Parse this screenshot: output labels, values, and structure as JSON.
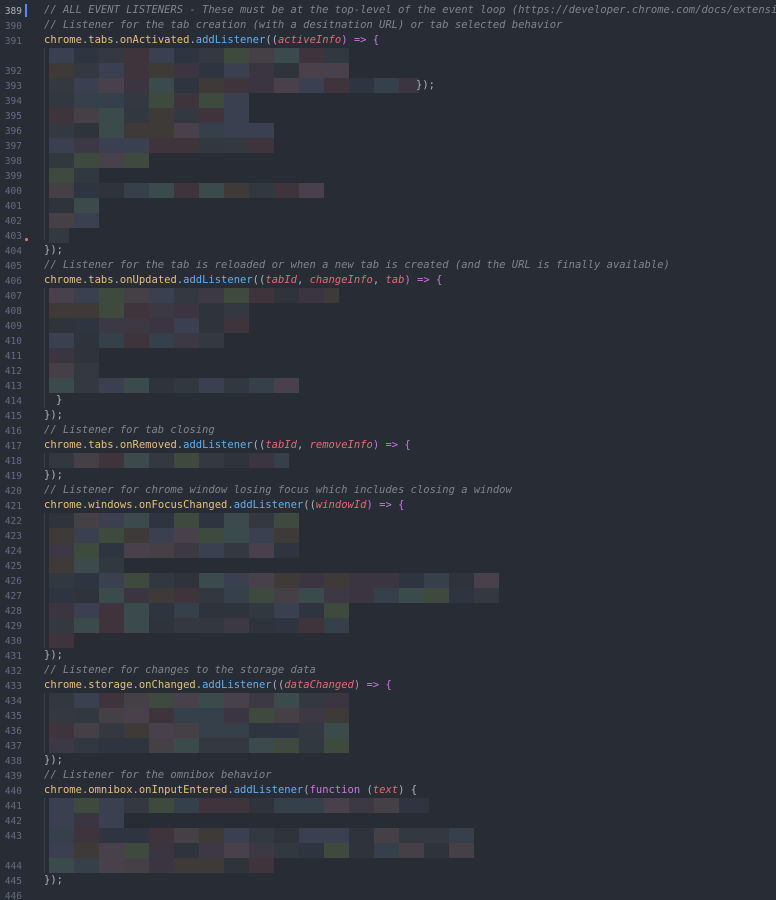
{
  "editor": {
    "line_numbers": [
      "389",
      "390",
      "391",
      "392",
      "393",
      "394",
      "395",
      "396",
      "397",
      "398",
      "399",
      "400",
      "401",
      "402",
      "403",
      "404",
      "405",
      "406",
      "407",
      "408",
      "409",
      "410",
      "411",
      "412",
      "413",
      "414",
      "415",
      "416",
      "417",
      "418",
      "419",
      "420",
      "421",
      "422",
      "423",
      "424",
      "425",
      "426",
      "427",
      "428",
      "429",
      "430",
      "431",
      "432",
      "433",
      "434",
      "435",
      "436",
      "437",
      "438",
      "439",
      "440",
      "441",
      "442",
      "443",
      "444",
      "445",
      "446"
    ],
    "lines": {
      "l389_comment": "// ALL EVENT LISTENERS - These must be at the top-level of the event loop (https://developer.chrome.com/docs/extensions/m",
      "l390_comment": "// Listener for the tab creation (with a desitnation URL) or tab selected behavior",
      "l391": {
        "obj": "chrome",
        "d1": ".",
        "ns": "tabs",
        "d2": ".",
        "ev": "onActivated",
        "d3": ".",
        "fn": "addListener",
        "open": "((",
        "params": "activeInfo",
        "arrow": ") => {"
      },
      "l394_tail": "});",
      "l405": "});",
      "l406_comment": "// Listener for the tab is reloaded or when a new tab is created (and the URL is finally available)",
      "l407": {
        "obj": "chrome",
        "d1": ".",
        "ns": "tabs",
        "d2": ".",
        "ev": "onUpdated",
        "d3": ".",
        "fn": "addListener",
        "open": "((",
        "p1": "tabId",
        "c1": ", ",
        "p2": "changeInfo",
        "c2": ", ",
        "p3": "tab",
        "arrow": ") => {"
      },
      "l415": "}",
      "l416": "});",
      "l417_comment": "// Listener for tab closing",
      "l418": {
        "obj": "chrome",
        "d1": ".",
        "ns": "tabs",
        "d2": ".",
        "ev": "onRemoved",
        "d3": ".",
        "fn": "addListener",
        "open": "((",
        "p1": "tabId",
        "c1": ", ",
        "p2": "removeInfo",
        "arrow": ") => {"
      },
      "l420": "});",
      "l421_comment": "// Listener for chrome window losing focus which includes closing a window",
      "l422": {
        "obj": "chrome",
        "d1": ".",
        "ns": "windows",
        "d2": ".",
        "ev": "onFocusChanged",
        "d3": ".",
        "fn": "addListener",
        "open": "((",
        "params": "windowId",
        "arrow": ") => {"
      },
      "l431": "});",
      "l432_comment": "// Listener for changes to the storage data",
      "l433": {
        "obj": "chrome",
        "d1": ".",
        "ns": "storage",
        "d2": ".",
        "ev": "onChanged",
        "d3": ".",
        "fn": "addListener",
        "open": "((",
        "params": "dataChanged",
        "arrow": ") => {"
      },
      "l438": "});",
      "l439_comment": "// Listener for the omnibox behavior",
      "l440": {
        "obj": "chrome",
        "d1": ".",
        "ns": "omnibox",
        "d2": ".",
        "ev": "onInputEntered",
        "d3": ".",
        "fn": "addListener",
        "open": "(",
        "kw": "function",
        "sp": " (",
        "params": "text",
        "arrow": ") {"
      },
      "l445": "});"
    }
  },
  "colors": {
    "background": "#282c34",
    "comment": "#7f848e",
    "object": "#e5c07b",
    "function": "#61afef",
    "parameter": "#e06c75",
    "keyword": "#c678dd",
    "cursor": "#528bff"
  }
}
